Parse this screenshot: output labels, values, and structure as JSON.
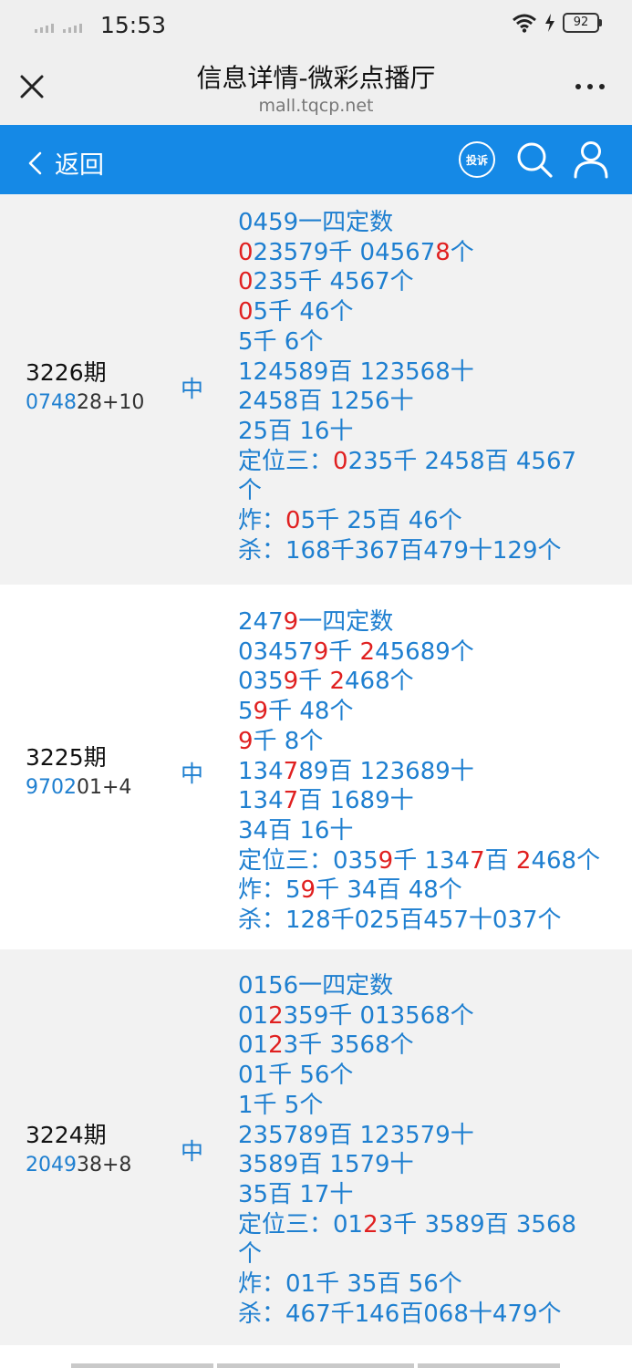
{
  "status_bar": {
    "time": "15:53",
    "battery": "92"
  },
  "browser": {
    "title": "信息详情-微彩点播厅",
    "url": "mall.tqcp.net"
  },
  "nav": {
    "back_label": "返回",
    "complain_label": "投诉"
  },
  "records": [
    {
      "issue": "3226期",
      "draw_highlight": "0748",
      "draw_rest": "28+10",
      "hit": "中",
      "lines": [
        [
          [
            "0459一四定数",
            false
          ]
        ],
        [
          [
            "0",
            true
          ],
          [
            "23579千 04567",
            false
          ],
          [
            "8",
            true
          ],
          [
            "个",
            false
          ]
        ],
        [
          [
            "0",
            true
          ],
          [
            "235千 4567个",
            false
          ]
        ],
        [
          [
            "0",
            true
          ],
          [
            "5千 46个",
            false
          ]
        ],
        [
          [
            "5千 6个",
            false
          ]
        ],
        [
          [
            "124589百 123568十",
            false
          ]
        ],
        [
          [
            "2458百 1256十",
            false
          ]
        ],
        [
          [
            "25百 16十",
            false
          ]
        ],
        [
          [
            "定位三：",
            false
          ],
          [
            "0",
            true
          ],
          [
            "235千 2458百 4567",
            false
          ]
        ],
        [
          [
            "个",
            false
          ]
        ],
        [
          [
            "炸：",
            false
          ],
          [
            "0",
            true
          ],
          [
            "5千 25百 46个",
            false
          ]
        ],
        [
          [
            "杀：168千367百479十129个",
            false
          ]
        ]
      ]
    },
    {
      "issue": "3225期",
      "draw_highlight": "9702",
      "draw_rest": "01+4",
      "hit": "中",
      "lines": [
        [
          [
            "247",
            false
          ],
          [
            "9",
            true
          ],
          [
            "一四定数",
            false
          ]
        ],
        [
          [
            "03457",
            false
          ],
          [
            "9",
            true
          ],
          [
            "千 ",
            false
          ],
          [
            "2",
            true
          ],
          [
            "45689个",
            false
          ]
        ],
        [
          [
            "035",
            false
          ],
          [
            "9",
            true
          ],
          [
            "千 ",
            false
          ],
          [
            "2",
            true
          ],
          [
            "468个",
            false
          ]
        ],
        [
          [
            "5",
            false
          ],
          [
            "9",
            true
          ],
          [
            "千 48个",
            false
          ]
        ],
        [
          [
            "9",
            true
          ],
          [
            "千 8个",
            false
          ]
        ],
        [
          [
            "134",
            false
          ],
          [
            "7",
            true
          ],
          [
            "89百 123689十",
            false
          ]
        ],
        [
          [
            "134",
            false
          ],
          [
            "7",
            true
          ],
          [
            "百 1689十",
            false
          ]
        ],
        [
          [
            "34百 16十",
            false
          ]
        ],
        [
          [
            "定位三：035",
            false
          ],
          [
            "9",
            true
          ],
          [
            "千 134",
            false
          ],
          [
            "7",
            true
          ],
          [
            "百 ",
            false
          ],
          [
            "2",
            true
          ],
          [
            "468个",
            false
          ]
        ],
        [
          [
            "炸：5",
            false
          ],
          [
            "9",
            true
          ],
          [
            "千 34百 48个",
            false
          ]
        ],
        [
          [
            "杀：128千025百457十037个",
            false
          ]
        ]
      ]
    },
    {
      "issue": "3224期",
      "draw_highlight": "2049",
      "draw_rest": "38+8",
      "hit": "中",
      "lines": [
        [
          [
            "0156一四定数",
            false
          ]
        ],
        [
          [
            "01",
            false
          ],
          [
            "2",
            true
          ],
          [
            "359千 013568个",
            false
          ]
        ],
        [
          [
            "01",
            false
          ],
          [
            "2",
            true
          ],
          [
            "3千 3568个",
            false
          ]
        ],
        [
          [
            "01千 56个",
            false
          ]
        ],
        [
          [
            "1千 5个",
            false
          ]
        ],
        [
          [
            "235789百 123579十",
            false
          ]
        ],
        [
          [
            "3589百 1579十",
            false
          ]
        ],
        [
          [
            "35百 17十",
            false
          ]
        ],
        [
          [
            "定位三：01",
            false
          ],
          [
            "2",
            true
          ],
          [
            "3千 3589百 3568",
            false
          ]
        ],
        [
          [
            "个",
            false
          ]
        ],
        [
          [
            "炸：01千 35百 56个",
            false
          ]
        ],
        [
          [
            "杀：467千146百068十479个",
            false
          ]
        ]
      ]
    }
  ]
}
